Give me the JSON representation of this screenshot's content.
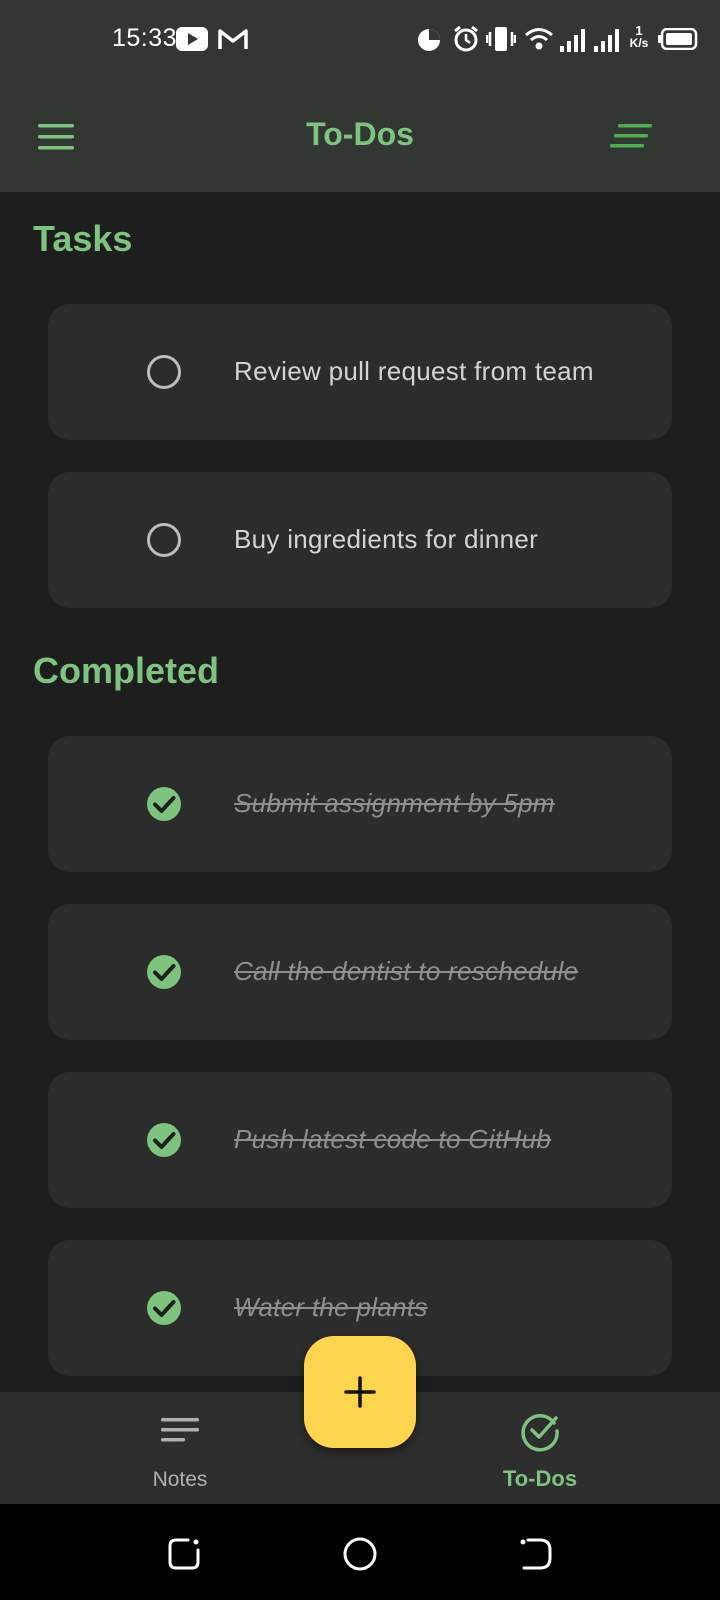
{
  "status_bar": {
    "time": "15:33",
    "net_speed_value": "1",
    "net_speed_unit": "K/s",
    "icons": [
      "youtube-icon",
      "gmail-icon",
      "data-usage-icon",
      "alarm-icon",
      "vibrate-icon",
      "wifi-icon",
      "signal-icon",
      "signal-icon",
      "battery-icon"
    ]
  },
  "app_bar": {
    "title": "To-Dos",
    "menu_icon": "menu-icon",
    "sort_icon": "sort-icon"
  },
  "sections": {
    "tasks": {
      "title": "Tasks",
      "items": [
        {
          "text": "Review pull request from team",
          "done": false
        },
        {
          "text": "Buy ingredients for dinner",
          "done": false
        }
      ]
    },
    "completed": {
      "title": "Completed",
      "items": [
        {
          "text": "Submit assignment by 5pm",
          "done": true
        },
        {
          "text": "Call the dentist to reschedule",
          "done": true
        },
        {
          "text": "Push latest code to GitHub",
          "done": true
        },
        {
          "text": "Water the plants",
          "done": true
        }
      ]
    }
  },
  "fab": {
    "icon": "plus-icon"
  },
  "bottom_nav": {
    "items": [
      {
        "label": "Notes",
        "icon": "notes-icon",
        "selected": false
      },
      {
        "label": "To-Dos",
        "icon": "check-circle-icon",
        "selected": true
      }
    ]
  },
  "system_nav": [
    "recents-icon",
    "home-icon",
    "back-icon"
  ],
  "colors": {
    "accent": "#7dc47e",
    "fab": "#ffd54f",
    "background": "#1e1e1e",
    "card": "#2c2c2c",
    "appbar": "#333734"
  }
}
